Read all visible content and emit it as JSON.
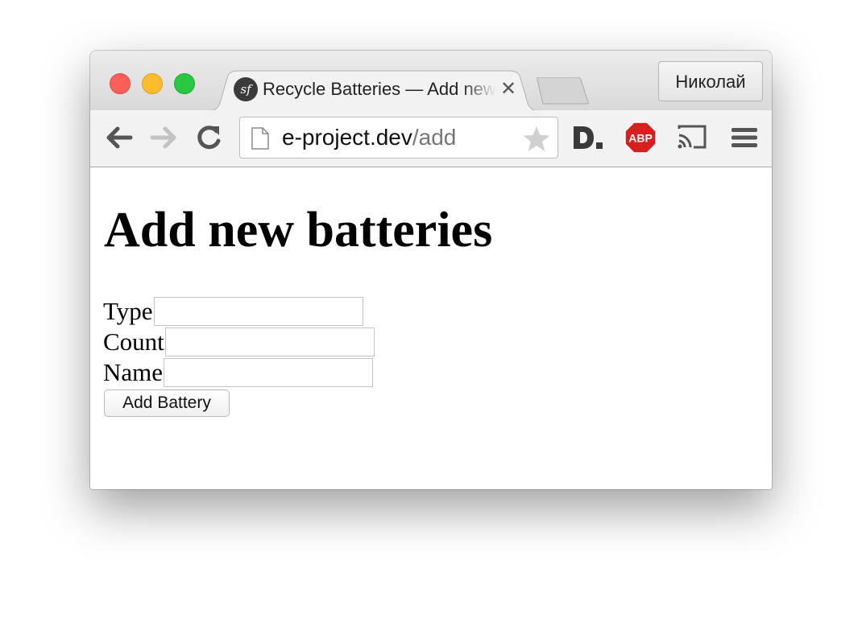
{
  "browser": {
    "tab": {
      "title": "Recycle Batteries — Add new batteries",
      "favicon_text": "sf",
      "close_glyph": "✕"
    },
    "profile_button": "Николай",
    "address_bar": {
      "host": "e-project.dev",
      "path": "/add"
    },
    "extensions": [
      "d-extension-icon",
      "adblock-plus-icon",
      "cast-icon"
    ],
    "icons": [
      "back-arrow-icon",
      "forward-arrow-icon",
      "reload-icon",
      "page-icon",
      "bookmark-star-icon",
      "menu-icon"
    ],
    "colors": {
      "close": "#fc5f57",
      "minimize": "#fdbc2e",
      "maximize": "#29c840",
      "abp_red": "#d7201e"
    }
  },
  "page": {
    "heading": "Add new batteries",
    "form": {
      "fields": [
        {
          "label": "Type",
          "value": ""
        },
        {
          "label": "Count",
          "value": ""
        },
        {
          "label": "Name",
          "value": ""
        }
      ],
      "submit_label": "Add Battery"
    }
  }
}
